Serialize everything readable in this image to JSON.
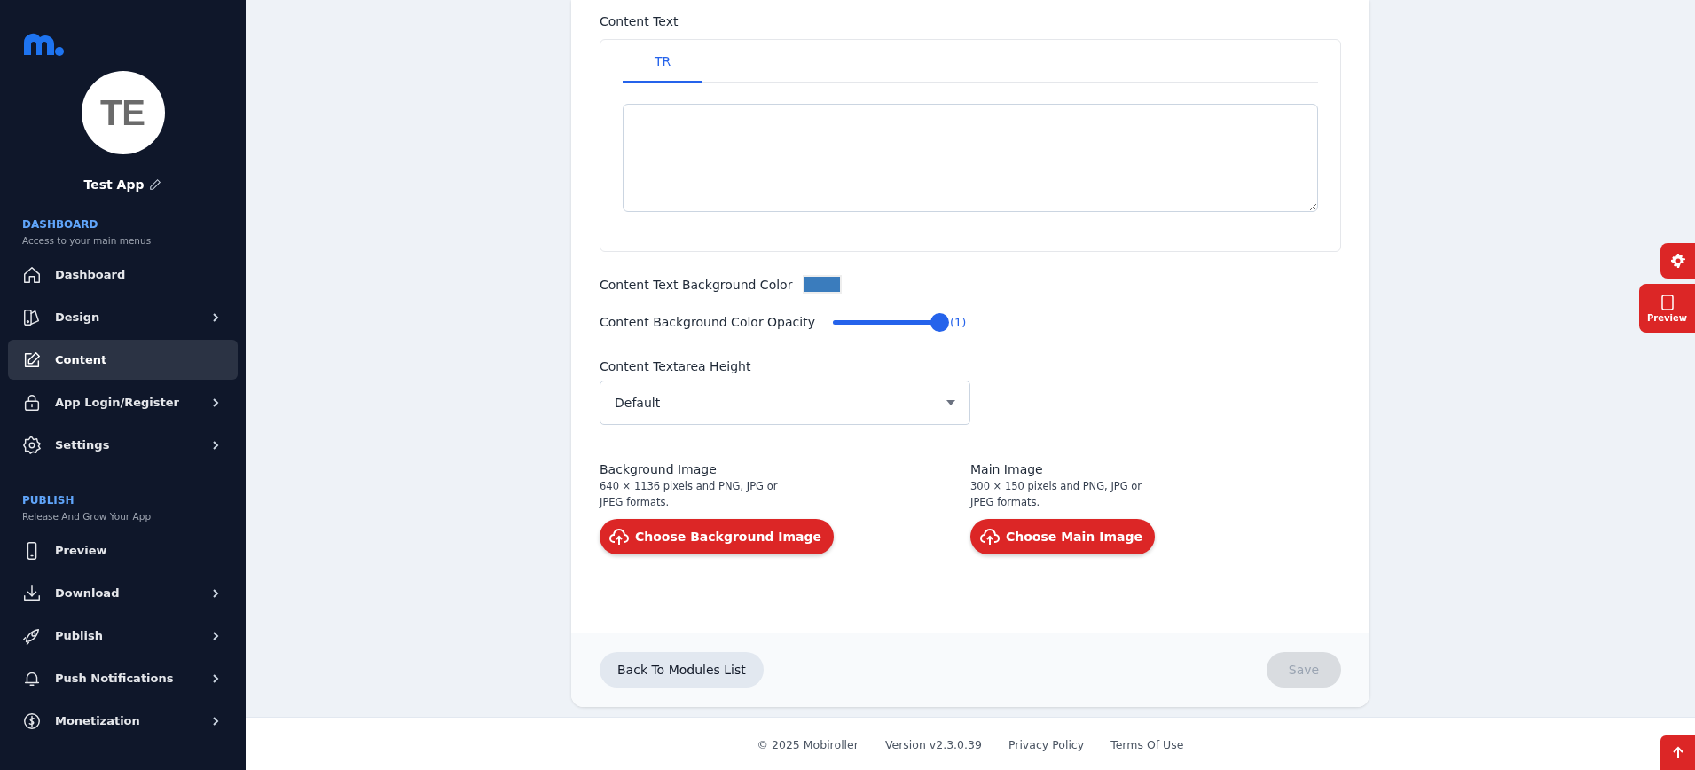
{
  "sidebar": {
    "app_name": "Test App",
    "avatar_initials": "TE",
    "sections": [
      {
        "title": "DASHBOARD",
        "subtitle": "Access to your main menus",
        "items": [
          {
            "label": "Dashboard",
            "selected": false,
            "expandable": false
          },
          {
            "label": "Design",
            "selected": false,
            "expandable": true
          },
          {
            "label": "Content",
            "selected": true,
            "expandable": false
          },
          {
            "label": "App Login/Register",
            "selected": false,
            "expandable": true
          },
          {
            "label": "Settings",
            "selected": false,
            "expandable": true
          }
        ]
      },
      {
        "title": "PUBLISH",
        "subtitle": "Release And Grow Your App",
        "items": [
          {
            "label": "Preview",
            "selected": false,
            "expandable": false
          },
          {
            "label": "Download",
            "selected": false,
            "expandable": true
          },
          {
            "label": "Publish",
            "selected": false,
            "expandable": true
          },
          {
            "label": "Push Notifications",
            "selected": false,
            "expandable": true
          },
          {
            "label": "Monetization",
            "selected": false,
            "expandable": true
          }
        ]
      }
    ]
  },
  "form": {
    "content_text": {
      "label": "Content Text",
      "tabs": [
        {
          "label": "TR",
          "selected": true
        }
      ]
    },
    "background_color": {
      "label": "Content Text Background Color",
      "color": "#3a7cbd"
    },
    "opacity": {
      "label": "Content Background Color Opacity",
      "level": 1,
      "reading": "(1)"
    },
    "textarea_height": {
      "label": "Content Textarea Height",
      "value": "Default"
    },
    "images": [
      {
        "title": "Background Image",
        "description": "640 × 1136 pixels and PNG, JPG or JPEG formats.",
        "button": "Choose Background Image"
      },
      {
        "title": "Main Image",
        "description": "300 × 150 pixels and PNG, JPG or JPEG formats.",
        "button": "Choose Main Image"
      }
    ],
    "back_button": "Back To Modules List",
    "save_button": {
      "label": "Save",
      "disabled": true
    }
  },
  "floating": {
    "preview_label": "Preview"
  },
  "footer": {
    "links": [
      "© 2025 Mobiroller",
      "Version v2.3.0.39",
      "Privacy Policy",
      "Terms Of Use"
    ]
  }
}
